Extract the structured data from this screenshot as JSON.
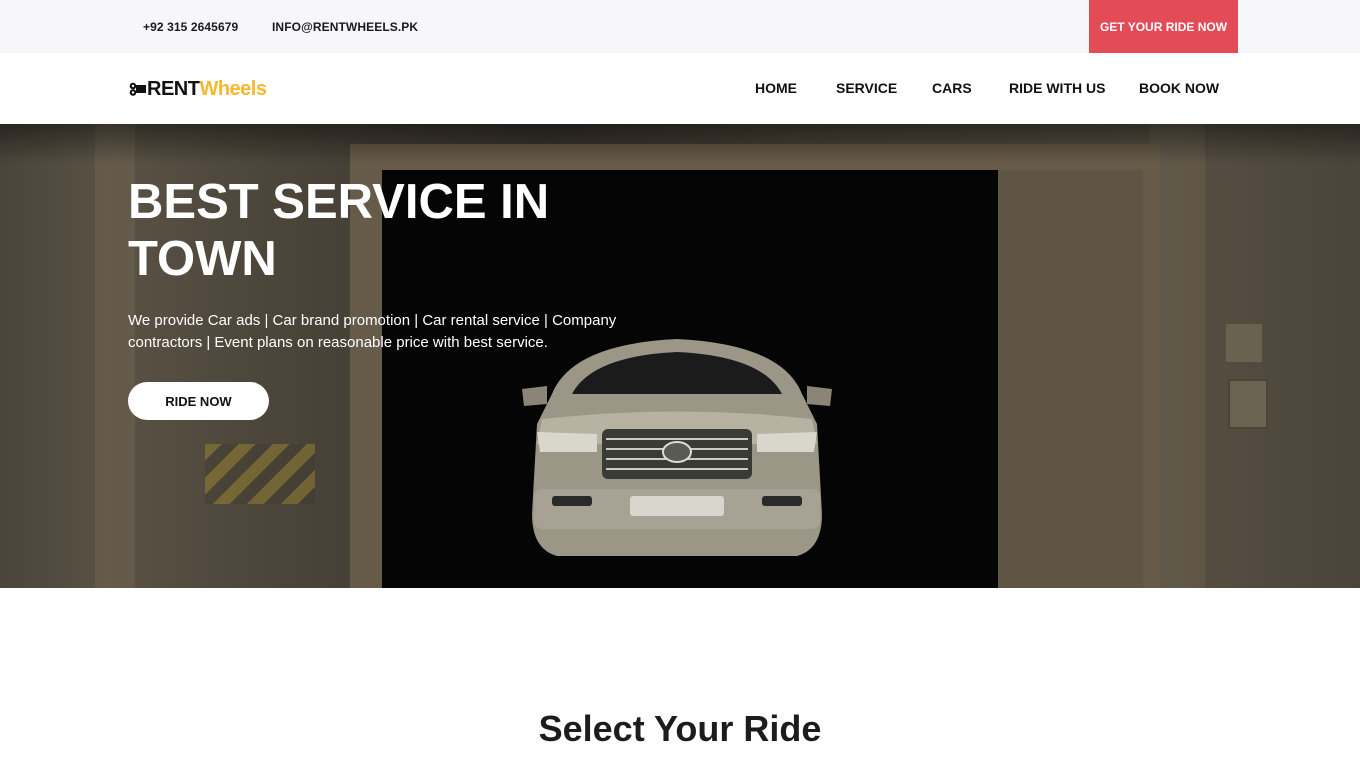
{
  "topbar": {
    "phone": "+92 315 2645679",
    "email": "INFO@RENTWHEELS.PK",
    "cta_label": "GET YOUR RIDE NOW"
  },
  "brand": {
    "logo_part1": "RENT",
    "logo_part2": "Wheels",
    "accent_color": "#f5b82e",
    "cta_color": "#e34b57"
  },
  "nav": {
    "items": [
      {
        "label": "HOME"
      },
      {
        "label": "SERVICE"
      },
      {
        "label": "CARS"
      },
      {
        "label": "RIDE WITH US"
      },
      {
        "label": "BOOK NOW"
      }
    ]
  },
  "hero": {
    "title": "BEST SERVICE IN TOWN",
    "description": "We provide Car ads | Car brand promotion | Car rental service | Company contractors | Event plans on reasonable price with best service.",
    "button_label": "RIDE NOW"
  },
  "section": {
    "title": "Select Your Ride"
  }
}
